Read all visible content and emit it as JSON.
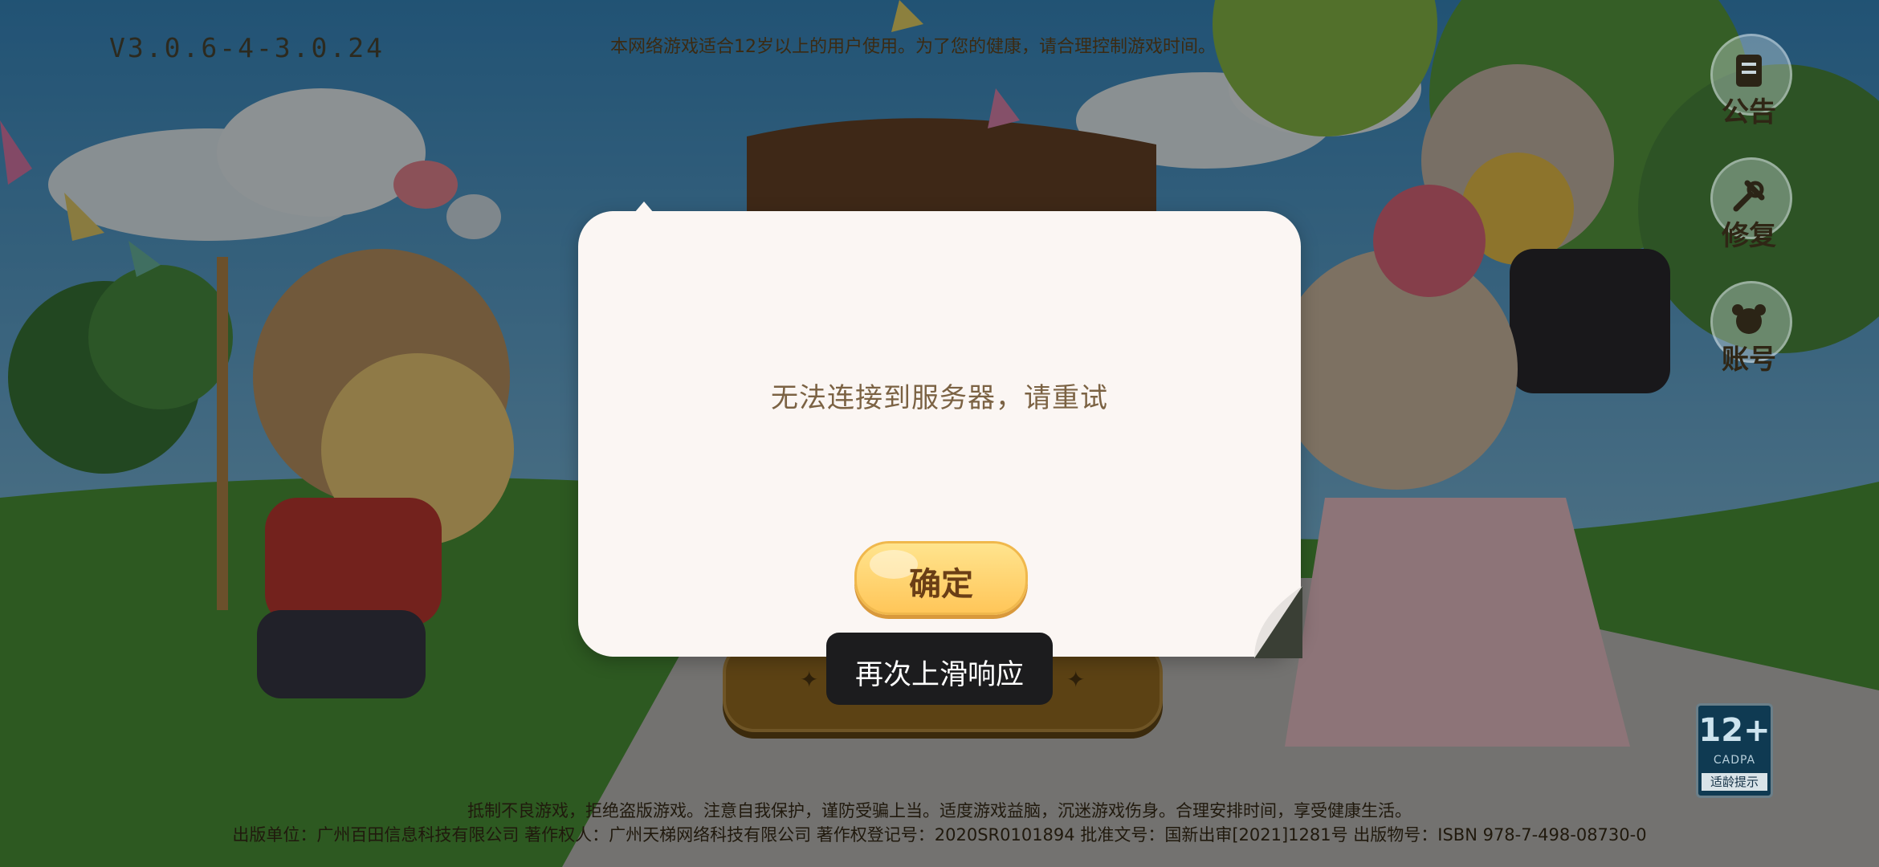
{
  "version": "V3.0.6-4-3.0.24",
  "health_notice": "本网络游戏适合12岁以上的用户使用。为了您的健康，请合理控制游戏时间。",
  "side_buttons": {
    "announcement": "公告",
    "repair": "修复",
    "account": "账号"
  },
  "age_rating": {
    "age": "12+",
    "org": "CADPA",
    "tip": "适龄提示"
  },
  "legal": {
    "line1": "抵制不良游戏，拒绝盗版游戏。注意自我保护，谨防受骗上当。适度游戏益脑，沉迷游戏伤身。合理安排时间，享受健康生活。",
    "line2": "出版单位：广州百田信息科技有限公司 著作权人：广州天梯网络科技有限公司 著作权登记号：2020SR0101894 批准文号：国新出审[2021]1281号 出版物号：ISBN 978-7-498-08730-0"
  },
  "dialog": {
    "message": "无法连接到服务器，请重试",
    "confirm_label": "确定"
  },
  "toast": {
    "text": "再次上滑响应"
  },
  "colors": {
    "dialog_bg": "#fbf6f3",
    "message_text": "#7b6243",
    "confirm_button": "#ffd36e",
    "toast_bg": "#1c1c1e"
  }
}
